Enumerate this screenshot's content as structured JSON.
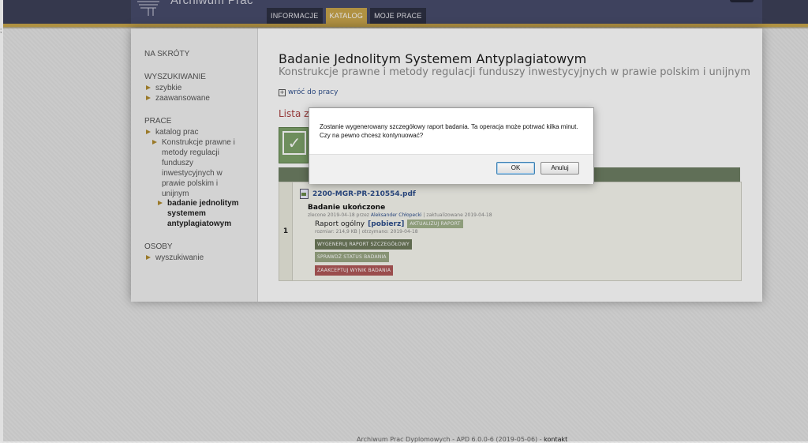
{
  "header": {
    "app_title": "Archiwum Prac",
    "tabs": [
      {
        "label": "INFORMACJE",
        "active": false
      },
      {
        "label": "KATALOG",
        "active": true
      },
      {
        "label": "MOJE PRACE",
        "active": false
      }
    ]
  },
  "sidebar": {
    "shortcuts_heading": "NA SKRÓTY",
    "search_heading": "WYSZUKIWANIE",
    "search_items": [
      "szybkie",
      "zaawansowane"
    ],
    "works_heading": "PRACE",
    "works_items": [
      "katalog prac",
      "Konstrukcje prawne i metody regulacji funduszy inwestycyjnych w prawie polskim i unijnym",
      "badanie jednolitym systemem antyplagiatowym"
    ],
    "people_heading": "OSOBY",
    "people_items": [
      "wyszukiwanie"
    ]
  },
  "main": {
    "title": "Badanie Jednolitym Systemem Antyplagiatowym",
    "subtitle": "Konstrukcje prawne i metody regulacji funduszy inwestycyjnych w prawie polskim i unijnym",
    "back_link": "wróć do pracy",
    "list_label": "Lista ze",
    "row": {
      "number": "1",
      "file_name": "2200-MGR-PR-210554.pdf",
      "status": "Badanie ukończone",
      "meta_prefix": "zlecone 2019-04-18 przez",
      "meta_author": "Aleksander Chłopecki",
      "meta_suffix": "| zaktualizowane 2019-04-18",
      "report_label": "Raport ogólny",
      "report_download": "[pobierz]",
      "update_tag": "AKTUALIZUJ RAPORT",
      "report_meta": "rozmiar: 214,9 KB | otrzymano: 2019-04-18",
      "actions": [
        "WYGENERUJ RAPORT SZCZEGÓŁOWY",
        "SPRAWDŹ STATUS BADANIA",
        "ZAAKCEPTUJ WYNIK BADANIA"
      ]
    }
  },
  "footer": {
    "text": "Archiwum Prac Dyplomowych - APD 6.0.0-6 (2019-05-06) -",
    "link": "kontakt"
  },
  "dialog": {
    "message": "Zostanie wygenerowany szczegółowy raport badania. Ta operacja może potrwać kilka minut. Czy na pewno chcesz kontynuować?",
    "ok_label": "OK",
    "cancel_label": "Anuluj"
  },
  "misc": {
    "edge_mark": ";"
  },
  "colors": {
    "header_bg": "#3d4058",
    "accent_gold": "#c9a54c",
    "link_blue": "#2e4f8c",
    "list_label_red": "#a94040",
    "action_generate": "#6e7a5c",
    "action_status": "#9aa884",
    "action_accept": "#b05858"
  }
}
